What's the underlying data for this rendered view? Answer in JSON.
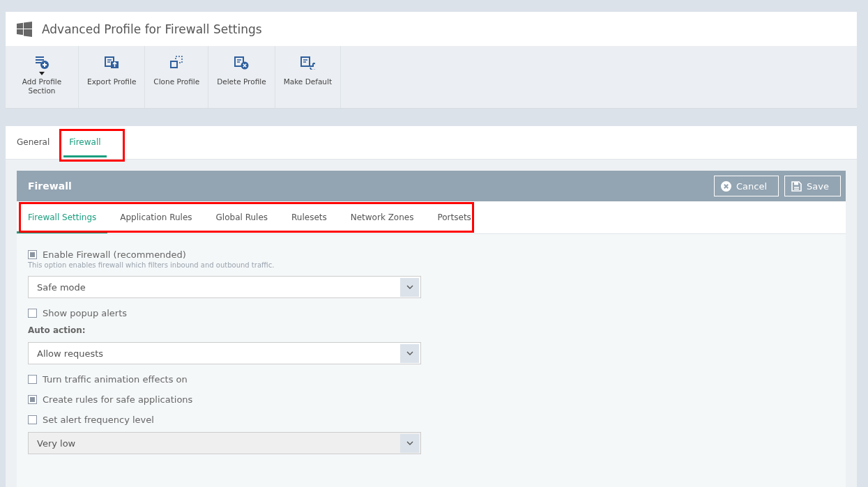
{
  "header": {
    "title": "Advanced Profile for Firewall Settings"
  },
  "toolbar": [
    {
      "kind": "add",
      "label": "Add Profile Section",
      "dropdown": true
    },
    {
      "kind": "export",
      "label": "Export Profile",
      "dropdown": false
    },
    {
      "kind": "clone",
      "label": "Clone Profile",
      "dropdown": false
    },
    {
      "kind": "delete",
      "label": "Delete Profile",
      "dropdown": false
    },
    {
      "kind": "default",
      "label": "Make Default",
      "dropdown": false
    }
  ],
  "tabs": [
    {
      "label": "General",
      "selected": false,
      "highlighted": false
    },
    {
      "label": "Firewall",
      "selected": true,
      "highlighted": true
    }
  ],
  "panel": {
    "title": "Firewall",
    "buttons": [
      {
        "kind": "cancel",
        "label": "Cancel"
      },
      {
        "kind": "save",
        "label": "Save"
      }
    ],
    "subtabs": {
      "highlighted": true,
      "items": [
        {
          "label": "Firewall Settings",
          "selected": true
        },
        {
          "label": "Application Rules",
          "selected": false
        },
        {
          "label": "Global Rules",
          "selected": false
        },
        {
          "label": "Rulesets",
          "selected": false
        },
        {
          "label": "Network Zones",
          "selected": false
        },
        {
          "label": "Portsets",
          "selected": false
        }
      ]
    },
    "settings": [
      {
        "kind": "checkbox",
        "label": "Enable Firewall (recommended)",
        "checked": true,
        "hint": "This option enables firewall which filters inbound and outbound traffic."
      },
      {
        "kind": "select",
        "value": "Safe mode",
        "disabled": false
      },
      {
        "kind": "checkbox",
        "label": "Show popup alerts",
        "checked": false
      },
      {
        "kind": "label",
        "label": "Auto action:"
      },
      {
        "kind": "select",
        "value": "Allow requests",
        "disabled": false
      },
      {
        "kind": "checkbox",
        "label": "Turn traffic animation effects on",
        "checked": false
      },
      {
        "kind": "checkbox",
        "label": "Create rules for safe applications",
        "checked": true
      },
      {
        "kind": "checkbox",
        "label": "Set alert frequency level",
        "checked": false
      },
      {
        "kind": "select",
        "value": "Very low",
        "disabled": true
      }
    ]
  }
}
